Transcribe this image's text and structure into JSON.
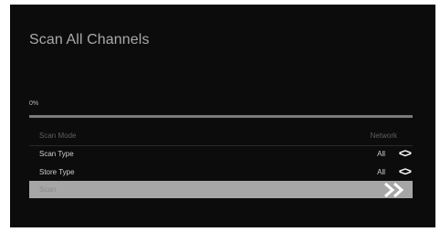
{
  "screen": {
    "title": "Scan All Channels"
  },
  "progress": {
    "label": "0%",
    "value": 0
  },
  "settings": {
    "scan_mode": {
      "label": "Scan Mode",
      "value": "Network"
    },
    "scan_type": {
      "label": "Scan Type",
      "value": "All",
      "arrows": "<>"
    },
    "store_type": {
      "label": "Store Type",
      "value": "All",
      "arrows": "<>"
    },
    "scan": {
      "label": "Scan",
      "value": "",
      "icon": "double-chevron-right-icon",
      "arrows": "»"
    }
  },
  "colors": {
    "background": "#0c0c0c",
    "highlight": "#a6a6a6",
    "text": "#cfcfcf"
  }
}
